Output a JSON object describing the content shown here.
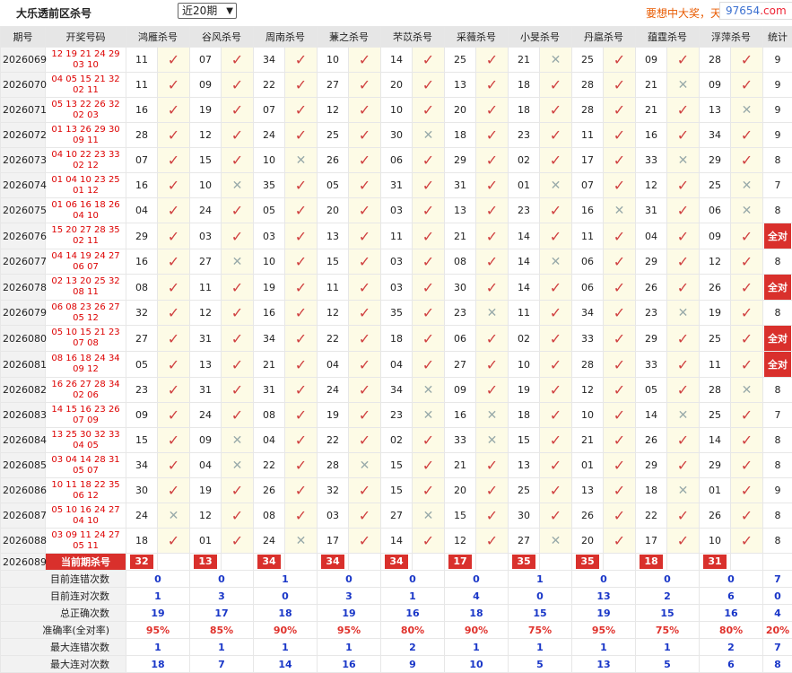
{
  "header": {
    "title": "大乐透前区杀号",
    "period_select": "近20期",
    "slogan": "要想中大奖，天",
    "watermark_a": "97654",
    "watermark_b": ".com"
  },
  "table": {
    "col_issue": "期号",
    "col_draw": "开奖号码",
    "experts": [
      "鸿雁杀号",
      "谷风杀号",
      "周南杀号",
      "蒹之杀号",
      "芣苡杀号",
      "采薇杀号",
      "小旻杀号",
      "丹扈杀号",
      "蕴霆杀号",
      "浮萍杀号"
    ],
    "col_count": "统计",
    "all_right_label": "全对",
    "rows": [
      {
        "issue": "2026069",
        "n1": "12 19 21 24 29",
        "n2": "03 10",
        "kills": [
          "11",
          "07",
          "34",
          "10",
          "14",
          "25",
          "21",
          "25",
          "09",
          "28"
        ],
        "ok": [
          1,
          1,
          1,
          1,
          1,
          1,
          0,
          1,
          1,
          1
        ],
        "count": "9"
      },
      {
        "issue": "2026070",
        "n1": "04 05 15 21 32",
        "n2": "02 11",
        "kills": [
          "11",
          "09",
          "22",
          "27",
          "20",
          "13",
          "18",
          "28",
          "21",
          "09"
        ],
        "ok": [
          1,
          1,
          1,
          1,
          1,
          1,
          1,
          1,
          0,
          1
        ],
        "count": "9"
      },
      {
        "issue": "2026071",
        "n1": "05 13 22 26 32",
        "n2": "02 03",
        "kills": [
          "16",
          "19",
          "07",
          "12",
          "10",
          "20",
          "18",
          "28",
          "21",
          "13"
        ],
        "ok": [
          1,
          1,
          1,
          1,
          1,
          1,
          1,
          1,
          1,
          0
        ],
        "count": "9"
      },
      {
        "issue": "2026072",
        "n1": "01 13 26 29 30",
        "n2": "09 11",
        "kills": [
          "28",
          "12",
          "24",
          "25",
          "30",
          "18",
          "23",
          "11",
          "16",
          "34"
        ],
        "ok": [
          1,
          1,
          1,
          1,
          0,
          1,
          1,
          1,
          1,
          1
        ],
        "count": "9"
      },
      {
        "issue": "2026073",
        "n1": "04 10 22 23 33",
        "n2": "02 12",
        "kills": [
          "07",
          "15",
          "10",
          "26",
          "06",
          "29",
          "02",
          "17",
          "33",
          "29"
        ],
        "ok": [
          1,
          1,
          0,
          1,
          1,
          1,
          1,
          1,
          0,
          1
        ],
        "count": "8"
      },
      {
        "issue": "2026074",
        "n1": "01 04 10 23 25",
        "n2": "01 12",
        "kills": [
          "16",
          "10",
          "35",
          "05",
          "31",
          "31",
          "01",
          "07",
          "12",
          "25"
        ],
        "ok": [
          1,
          0,
          1,
          1,
          1,
          1,
          0,
          1,
          1,
          0
        ],
        "count": "7"
      },
      {
        "issue": "2026075",
        "n1": "01 06 16 18 26",
        "n2": "04 10",
        "kills": [
          "04",
          "24",
          "05",
          "20",
          "03",
          "13",
          "23",
          "16",
          "31",
          "06"
        ],
        "ok": [
          1,
          1,
          1,
          1,
          1,
          1,
          1,
          0,
          1,
          0
        ],
        "count": "8"
      },
      {
        "issue": "2026076",
        "n1": "15 20 27 28 35",
        "n2": "02 11",
        "kills": [
          "29",
          "03",
          "03",
          "13",
          "11",
          "21",
          "14",
          "11",
          "04",
          "09"
        ],
        "ok": [
          1,
          1,
          1,
          1,
          1,
          1,
          1,
          1,
          1,
          1
        ],
        "count": "全对"
      },
      {
        "issue": "2026077",
        "n1": "04 14 19 24 27",
        "n2": "06 07",
        "kills": [
          "16",
          "27",
          "10",
          "15",
          "03",
          "08",
          "14",
          "06",
          "29",
          "12"
        ],
        "ok": [
          1,
          0,
          1,
          1,
          1,
          1,
          0,
          1,
          1,
          1
        ],
        "count": "8"
      },
      {
        "issue": "2026078",
        "n1": "02 13 20 25 32",
        "n2": "08 11",
        "kills": [
          "08",
          "11",
          "19",
          "11",
          "03",
          "30",
          "14",
          "06",
          "26",
          "26"
        ],
        "ok": [
          1,
          1,
          1,
          1,
          1,
          1,
          1,
          1,
          1,
          1
        ],
        "count": "全对"
      },
      {
        "issue": "2026079",
        "n1": "06 08 23 26 27",
        "n2": "05 12",
        "kills": [
          "32",
          "12",
          "16",
          "12",
          "35",
          "23",
          "11",
          "34",
          "23",
          "19"
        ],
        "ok": [
          1,
          1,
          1,
          1,
          1,
          0,
          1,
          1,
          0,
          1
        ],
        "count": "8"
      },
      {
        "issue": "2026080",
        "n1": "05 10 15 21 23",
        "n2": "07 08",
        "kills": [
          "27",
          "31",
          "34",
          "22",
          "18",
          "06",
          "02",
          "33",
          "29",
          "25"
        ],
        "ok": [
          1,
          1,
          1,
          1,
          1,
          1,
          1,
          1,
          1,
          1
        ],
        "count": "全对"
      },
      {
        "issue": "2026081",
        "n1": "08 16 18 24 34",
        "n2": "09 12",
        "kills": [
          "05",
          "13",
          "21",
          "04",
          "04",
          "27",
          "10",
          "28",
          "33",
          "11"
        ],
        "ok": [
          1,
          1,
          1,
          1,
          1,
          1,
          1,
          1,
          1,
          1
        ],
        "count": "全对"
      },
      {
        "issue": "2026082",
        "n1": "16 26 27 28 34",
        "n2": "02 06",
        "kills": [
          "23",
          "31",
          "31",
          "24",
          "34",
          "09",
          "19",
          "12",
          "05",
          "28"
        ],
        "ok": [
          1,
          1,
          1,
          1,
          0,
          1,
          1,
          1,
          1,
          0
        ],
        "count": "8"
      },
      {
        "issue": "2026083",
        "n1": "14 15 16 23 26",
        "n2": "07 09",
        "kills": [
          "09",
          "24",
          "08",
          "19",
          "23",
          "16",
          "18",
          "10",
          "14",
          "25"
        ],
        "ok": [
          1,
          1,
          1,
          1,
          0,
          0,
          1,
          1,
          0,
          1
        ],
        "count": "7"
      },
      {
        "issue": "2026084",
        "n1": "13 25 30 32 33",
        "n2": "04 05",
        "kills": [
          "15",
          "09",
          "04",
          "22",
          "02",
          "33",
          "15",
          "21",
          "26",
          "14"
        ],
        "ok": [
          1,
          0,
          1,
          1,
          1,
          0,
          1,
          1,
          1,
          1
        ],
        "count": "8"
      },
      {
        "issue": "2026085",
        "n1": "03 04 14 28 31",
        "n2": "05 07",
        "kills": [
          "34",
          "04",
          "22",
          "28",
          "15",
          "21",
          "13",
          "01",
          "29",
          "29"
        ],
        "ok": [
          1,
          0,
          1,
          0,
          1,
          1,
          1,
          1,
          1,
          1
        ],
        "count": "8"
      },
      {
        "issue": "2026086",
        "n1": "10 11 18 22 35",
        "n2": "06 12",
        "kills": [
          "30",
          "19",
          "26",
          "32",
          "15",
          "20",
          "25",
          "13",
          "18",
          "01"
        ],
        "ok": [
          1,
          1,
          1,
          1,
          1,
          1,
          1,
          1,
          0,
          1
        ],
        "count": "9"
      },
      {
        "issue": "2026087",
        "n1": "05 10 16 24 27",
        "n2": "04 10",
        "kills": [
          "24",
          "12",
          "08",
          "03",
          "27",
          "15",
          "30",
          "26",
          "22",
          "26"
        ],
        "ok": [
          0,
          1,
          1,
          1,
          0,
          1,
          1,
          1,
          1,
          1
        ],
        "count": "8"
      },
      {
        "issue": "2026088",
        "n1": "03 09 11 24 27",
        "n2": "05 11",
        "kills": [
          "18",
          "01",
          "24",
          "17",
          "14",
          "12",
          "27",
          "20",
          "17",
          "10"
        ],
        "ok": [
          1,
          1,
          0,
          1,
          1,
          1,
          0,
          1,
          1,
          1
        ],
        "count": "8"
      }
    ],
    "current": {
      "issue": "2026089",
      "label": "当前期杀号",
      "kills": [
        "32",
        "13",
        "34",
        "34",
        "34",
        "17",
        "35",
        "35",
        "18",
        "31"
      ]
    },
    "stats": [
      {
        "label": "目前连错次数",
        "values": [
          "0",
          "0",
          "1",
          "0",
          "0",
          "0",
          "1",
          "0",
          "0",
          "0"
        ],
        "total": "7",
        "cls": "blue"
      },
      {
        "label": "目前连对次数",
        "values": [
          "1",
          "3",
          "0",
          "3",
          "1",
          "4",
          "0",
          "13",
          "2",
          "6"
        ],
        "total": "0",
        "cls": "blue"
      },
      {
        "label": "总正确次数",
        "values": [
          "19",
          "17",
          "18",
          "19",
          "16",
          "18",
          "15",
          "19",
          "15",
          "16"
        ],
        "total": "4",
        "cls": "blue"
      },
      {
        "label": "准确率(全对率)",
        "values": [
          "95%",
          "85%",
          "90%",
          "95%",
          "80%",
          "90%",
          "75%",
          "95%",
          "75%",
          "80%"
        ],
        "total": "20%",
        "cls": "red"
      },
      {
        "label": "最大连错次数",
        "values": [
          "1",
          "1",
          "1",
          "1",
          "2",
          "1",
          "1",
          "1",
          "1",
          "2"
        ],
        "total": "7",
        "cls": "blue"
      },
      {
        "label": "最大连对次数",
        "values": [
          "18",
          "7",
          "14",
          "16",
          "9",
          "10",
          "5",
          "13",
          "5",
          "6"
        ],
        "total": "8",
        "cls": "blue"
      }
    ]
  }
}
